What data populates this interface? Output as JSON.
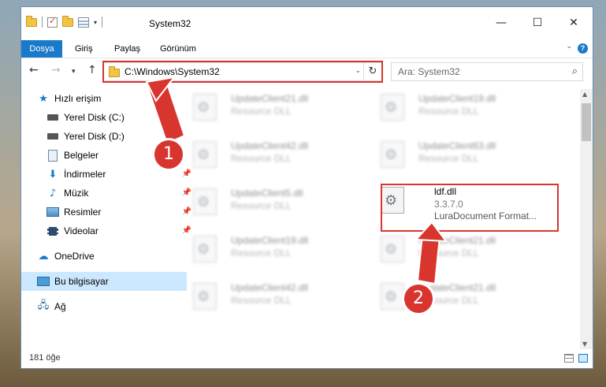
{
  "window": {
    "title": "System32"
  },
  "window_controls": {
    "minimize": "—",
    "maximize": "☐",
    "close": "✕"
  },
  "menu": {
    "tabs": [
      "Dosya",
      "Giriş",
      "Paylaş",
      "Görünüm"
    ]
  },
  "address": {
    "path": "C:\\Windows\\System32"
  },
  "search": {
    "placeholder": "Ara: System32"
  },
  "sidebar": {
    "items": [
      {
        "label": "Hızlı erişim",
        "icon": "star-icon"
      },
      {
        "label": "Yerel Disk (C:)",
        "icon": "drive-icon"
      },
      {
        "label": "Yerel Disk (D:)",
        "icon": "drive-icon"
      },
      {
        "label": "Belgeler",
        "icon": "document-icon"
      },
      {
        "label": "İndirmeler",
        "icon": "download-icon"
      },
      {
        "label": "Müzik",
        "icon": "music-icon"
      },
      {
        "label": "Resimler",
        "icon": "pictures-icon"
      },
      {
        "label": "Videolar",
        "icon": "video-icon"
      },
      {
        "label": "OneDrive",
        "icon": "cloud-icon"
      },
      {
        "label": "Bu bilgisayar",
        "icon": "computer-icon"
      },
      {
        "label": "Ağ",
        "icon": "network-icon"
      }
    ]
  },
  "files": [
    {
      "name": "UpdateClient21.dll",
      "sub": "Resource DLL"
    },
    {
      "name": "UpdateClient19.dll",
      "sub": "Resource DLL"
    },
    {
      "name": "UpdateClient42.dll",
      "sub": "Resource DLL"
    },
    {
      "name": "UpdateClient63.dll",
      "sub": "Resource DLL"
    },
    {
      "name": "UpdateClient5.dll",
      "sub": "Resource DLL"
    },
    {
      "name": "ldf.dll",
      "sub": "3.3.7.0",
      "sub2": "LuraDocument Format..."
    },
    {
      "name": "UpdateClient19.dll",
      "sub": "Resource DLL"
    },
    {
      "name": "UpdateClient21.dll",
      "sub": "Resource DLL"
    },
    {
      "name": "UpdateClient42.dll",
      "sub": "Resource DLL"
    },
    {
      "name": "UpdateClient21.dll",
      "sub": "Resource DLL"
    }
  ],
  "status": {
    "count": "181 öğe"
  },
  "callouts": [
    "1",
    "2"
  ],
  "colors": {
    "accent": "#1979ca",
    "highlight": "#d8352f",
    "selected": "#cce8ff"
  }
}
